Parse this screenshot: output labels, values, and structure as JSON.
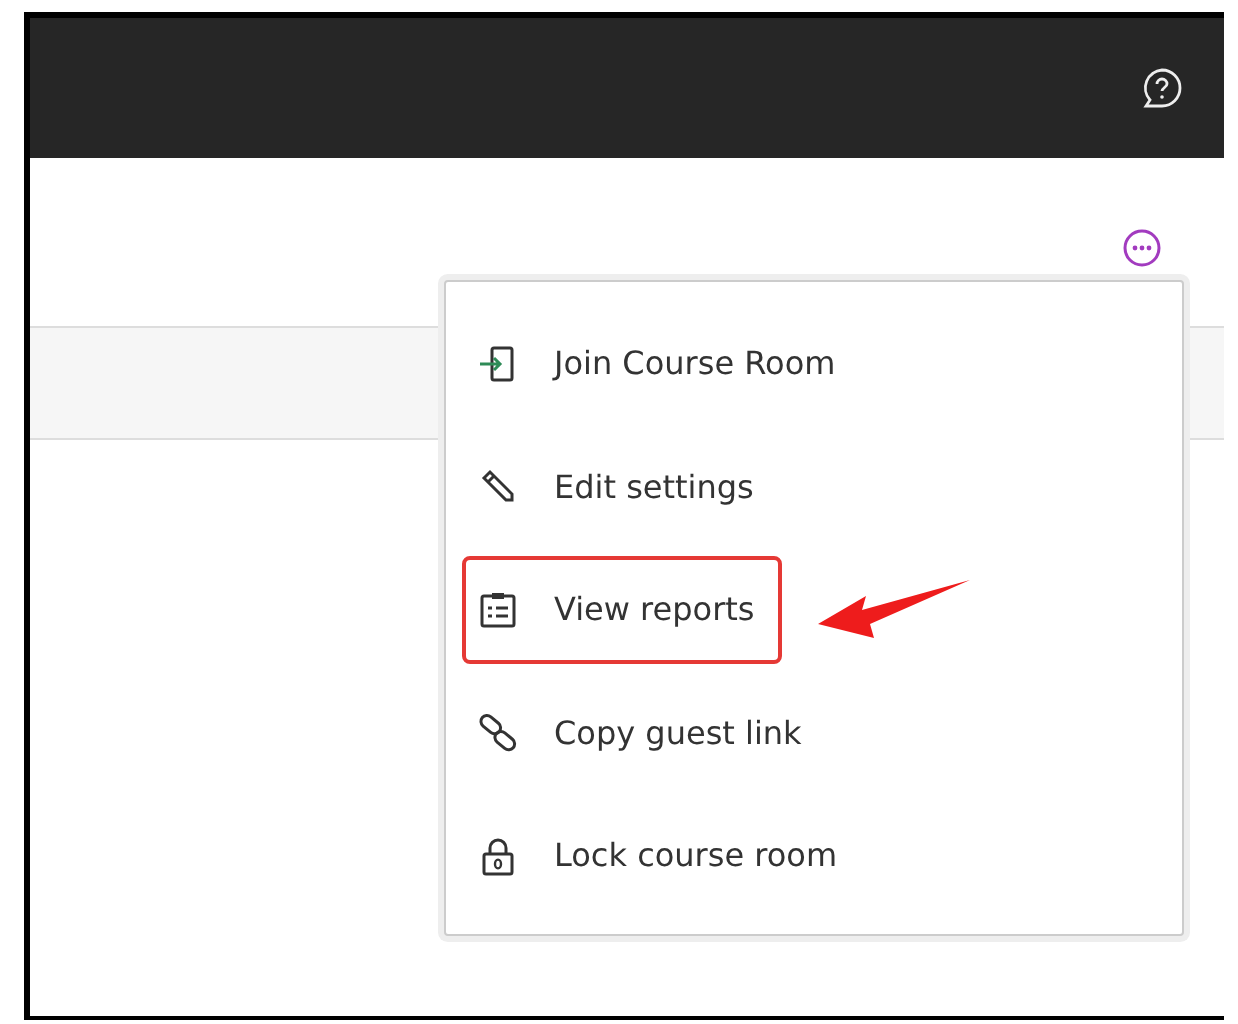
{
  "menu": {
    "items": [
      {
        "kind": "join",
        "label": "Join Course Room",
        "highlighted": false
      },
      {
        "kind": "edit",
        "label": "Edit settings",
        "highlighted": false
      },
      {
        "kind": "reports",
        "label": "View reports",
        "highlighted": true
      },
      {
        "kind": "link",
        "label": "Copy guest link",
        "highlighted": false
      },
      {
        "kind": "lock",
        "label": "Lock course room",
        "highlighted": false
      }
    ]
  }
}
